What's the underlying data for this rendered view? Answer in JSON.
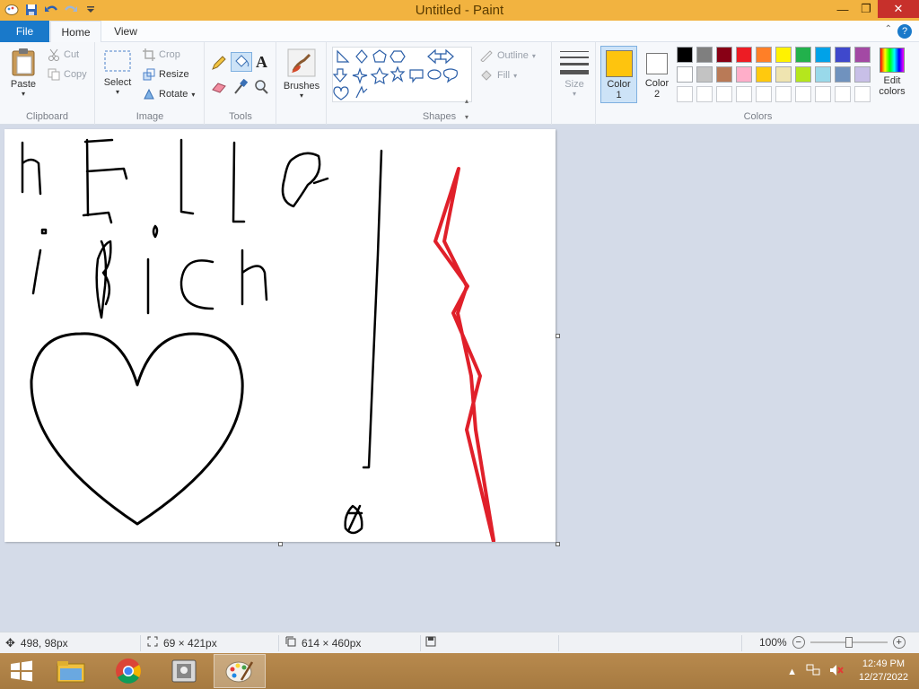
{
  "window": {
    "title": "Untitled - Paint"
  },
  "tabs": [
    {
      "label": "File"
    },
    {
      "label": "Home"
    },
    {
      "label": "View"
    }
  ],
  "ribbon": {
    "clipboard": {
      "label": "Clipboard",
      "paste": "Paste",
      "cut": "Cut",
      "copy": "Copy"
    },
    "image": {
      "label": "Image",
      "select": "Select",
      "crop": "Crop",
      "resize": "Resize",
      "rotate": "Rotate"
    },
    "tools": {
      "label": "Tools"
    },
    "brushes": {
      "label": "Brushes"
    },
    "shapes": {
      "label": "Shapes",
      "outline": "Outline",
      "fill": "Fill"
    },
    "size": {
      "label": "Size"
    },
    "color1": {
      "label": "Color",
      "num": "1",
      "value": "#fec40e"
    },
    "color2": {
      "label": "Color",
      "num": "2",
      "value": "#ffffff"
    },
    "colors": {
      "label": "Colors",
      "edit_line1": "Edit",
      "edit_line2": "colors"
    },
    "palette": [
      "#000000",
      "#7f7f7f",
      "#880015",
      "#ed1c24",
      "#ff7f27",
      "#fff200",
      "#22b14c",
      "#00a2e8",
      "#3f48cc",
      "#a349a4",
      "#ffffff",
      "#c3c3c3",
      "#b97a57",
      "#ffaec9",
      "#ffc90e",
      "#efe4b0",
      "#b5e61d",
      "#99d9ea",
      "#7092be",
      "#c8bfe7"
    ]
  },
  "status": {
    "cursor": "498, 98px",
    "selection": "69 × 421px",
    "canvas_size": "614 × 460px",
    "zoom": "100%"
  },
  "clock": {
    "time": "12:49 PM",
    "date": "12/27/2022"
  },
  "drawing_colors": {
    "black": "#000000",
    "red": "#e0202a"
  }
}
